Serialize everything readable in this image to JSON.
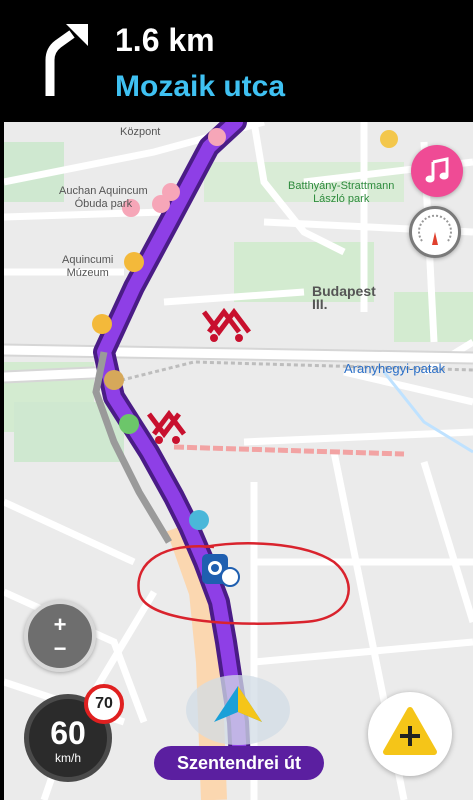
{
  "navigation": {
    "distance": "1.6 km",
    "street": "Mozaik utca",
    "maneuver_icon": "turn-slight-right-icon"
  },
  "map": {
    "labels": {
      "kozpont": "Központ",
      "auchan": "Auchan Aquincum\nÓbuda park",
      "aquincumi": "Aquincumi\nMúzeum",
      "batthyany": "Batthyány-Strattmann\nLászló park",
      "budapest": "Budapest\nIII.",
      "aranyhegyi": "Aranyhegyi-patak"
    },
    "route_color": "#7b2fd0",
    "annotation_color": "#d9232d"
  },
  "controls": {
    "music_icon": "music-note-icon",
    "speedometer_icon": "speedometer-icon",
    "zoom_in": "+",
    "zoom_out": "−",
    "report_icon": "report-plus-icon"
  },
  "speed": {
    "current": "60",
    "unit": "km/h",
    "limit": "70"
  },
  "current_road": "Szentendrei út",
  "colors": {
    "banner_background": "#000000",
    "street_text": "#3fc1f2",
    "music_button": "#ef4b95",
    "road_label_background": "#5b1fa0",
    "report_yellow": "#f5c518"
  }
}
